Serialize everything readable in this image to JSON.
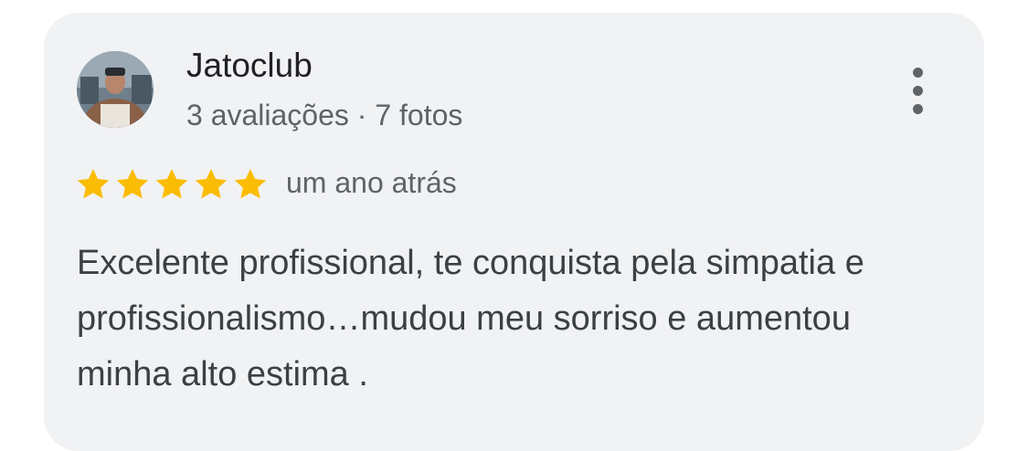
{
  "review": {
    "reviewer_name": "Jatoclub",
    "reviewer_meta": "3 avaliações · 7 fotos",
    "rating": 5,
    "rating_max": 5,
    "star_color": "#fbbc04",
    "date": "um ano atrás",
    "text": "Excelente profissional, te conquista pela simpatia e profissionalismo…mudou meu sorriso e aumentou minha alto estima ."
  },
  "icons": {
    "avatar": "avatar-photo",
    "more": "more-vertical-icon",
    "star": "star-icon"
  }
}
